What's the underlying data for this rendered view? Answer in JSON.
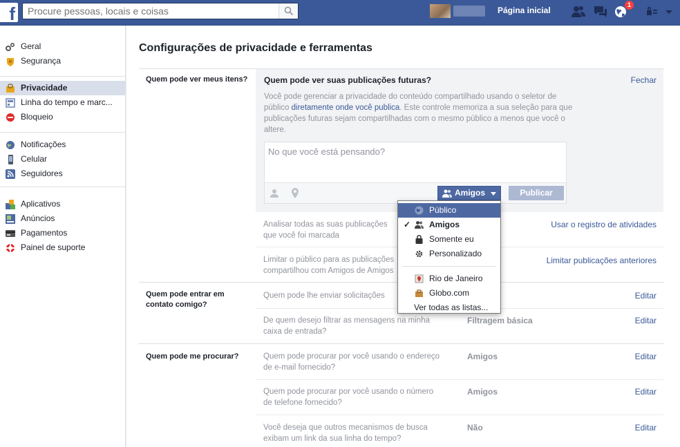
{
  "topbar": {
    "logo": "f",
    "search_placeholder": "Procure pessoas, locais e coisas",
    "profile_name": "",
    "home": "Página inicial",
    "notification_count": "1",
    "icons": [
      "friends-icon",
      "messages-icon",
      "notifications-globe-icon",
      "settings-icon"
    ]
  },
  "sidebar": {
    "groups": [
      [
        {
          "label": "Geral",
          "icon": "gear-icon"
        },
        {
          "label": "Segurança",
          "icon": "shield-icon"
        }
      ],
      [
        {
          "label": "Privacidade",
          "icon": "lock-icon",
          "active": true
        },
        {
          "label": "Linha do tempo e marc...",
          "icon": "timeline-icon"
        },
        {
          "label": "Bloqueio",
          "icon": "block-icon"
        }
      ],
      [
        {
          "label": "Notificações",
          "icon": "globe-icon"
        },
        {
          "label": "Celular",
          "icon": "phone-icon"
        },
        {
          "label": "Seguidores",
          "icon": "rss-icon"
        }
      ],
      [
        {
          "label": "Aplicativos",
          "icon": "apps-icon"
        },
        {
          "label": "Anúncios",
          "icon": "ads-icon"
        },
        {
          "label": "Pagamentos",
          "icon": "card-icon"
        },
        {
          "label": "Painel de suporte",
          "icon": "lifebuoy-icon"
        }
      ]
    ]
  },
  "main": {
    "title": "Configurações de privacidade e ferramentas",
    "sections": [
      {
        "label": "Quem pode ver meus itens?"
      },
      {
        "label": "Quem pode entrar em contato comigo?"
      },
      {
        "label": "Quem pode me procurar?"
      }
    ],
    "expanded": {
      "title": "Quem pode ver suas publicações futuras?",
      "close": "Fechar",
      "desc_1": "Você pode gerenciar a privacidade do conteúdo compartilhado usando o seletor de público ",
      "desc_link": "diretamente onde você publica",
      "desc_2": ". Este controle memoriza a sua seleção para que publicações futuras sejam compartilhadas com o mesmo público a menos que você o altere.",
      "composer_placeholder": "No que você está pensando?",
      "audience": "Amigos",
      "post": "Publicar"
    },
    "rows": [
      {
        "text_1": "Analisar todas as suas publicações",
        "text_2": "que você foi marcada",
        "value": "",
        "link": "Usar o registro de atividades"
      },
      {
        "text_1": "Limitar o público para as publicações",
        "text_2": "compartilhou com Amigos de Amigos",
        "value": "",
        "link": "Limitar publicações anteriores"
      },
      {
        "text_1": "Quem pode lhe enviar solicitações",
        "text_2": "",
        "value": "",
        "link": "Editar"
      },
      {
        "text_1": "De quem desejo filtrar as mensagens na minha",
        "text_2": "caixa de entrada?",
        "value": "Filtragem básica",
        "link": "Editar"
      },
      {
        "text_1": "Quem pode procurar por você usando o endereço",
        "text_2": "de e-mail fornecido?",
        "value": "Amigos",
        "link": "Editar"
      },
      {
        "text_1": "Quem pode procurar por você usando o número",
        "text_2": "de telefone fornecido?",
        "value": "Amigos",
        "link": "Editar"
      },
      {
        "text_1": "Você deseja que outros mecanismos de busca",
        "text_2": "exibam um link da sua linha do tempo?",
        "value": "Não",
        "link": "Editar"
      }
    ]
  },
  "dropdown": {
    "items": [
      {
        "label": "Público",
        "icon": "globe-icon",
        "highlighted": true
      },
      {
        "label": "Amigos",
        "icon": "friends-icon",
        "selected": true
      },
      {
        "label": "Somente eu",
        "icon": "lock-icon"
      },
      {
        "label": "Personalizado",
        "icon": "gear-icon"
      }
    ],
    "lists": [
      {
        "label": "Rio de Janeiro",
        "icon": "location-list-icon"
      },
      {
        "label": "Globo.com",
        "icon": "work-list-icon"
      }
    ],
    "see_all": "Ver todas as listas..."
  },
  "colors": {
    "brand": "#3b5998",
    "link": "#3b5998",
    "muted": "#90949c"
  }
}
